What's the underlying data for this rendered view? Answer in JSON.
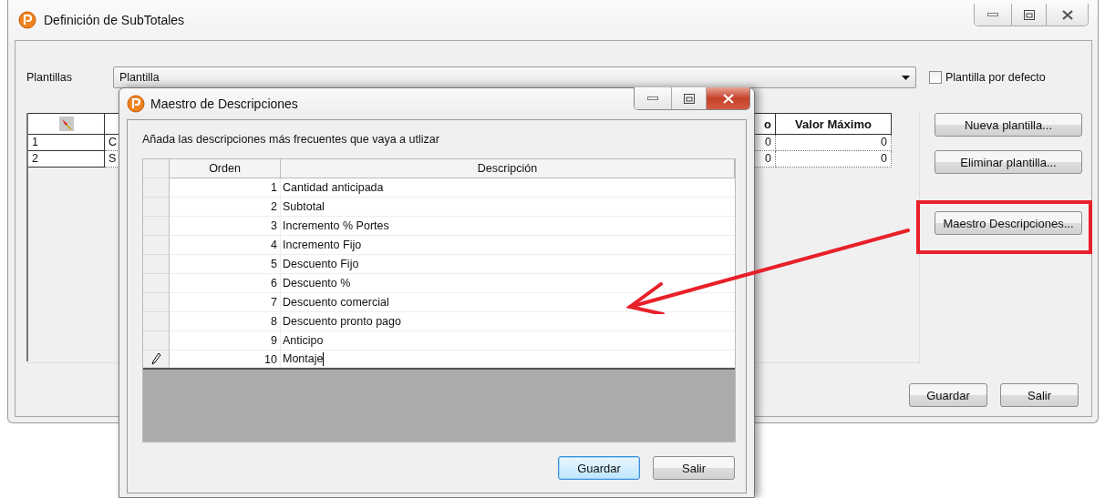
{
  "main_window": {
    "title": "Definición de SubTotales",
    "template_label": "Plantillas",
    "template_value": "Plantilla",
    "default_checkbox": {
      "label": "Plantilla por defecto",
      "checked": false
    },
    "table": {
      "columns": [
        {
          "kind": "pin"
        },
        {
          "kind": "blank"
        },
        {
          "kind": "text",
          "label": "o"
        },
        {
          "kind": "text",
          "label": "Valor Máximo"
        }
      ],
      "rows": [
        [
          "1",
          "C",
          "0",
          "0"
        ],
        [
          "2",
          "S",
          "0",
          "0"
        ]
      ]
    },
    "side_buttons": [
      "Nueva plantilla...",
      "Eliminar plantilla...",
      "Maestro Descripciones..."
    ],
    "footer_buttons": [
      "Guardar",
      "Salir"
    ]
  },
  "dialog": {
    "title": "Maestro de Descripciones",
    "instruction": "Añada las descripciones más frecuentes que vaya a utlizar",
    "columns": [
      "Orden",
      "Descripción"
    ],
    "rows": [
      {
        "order": "1",
        "description": "Cantidad anticipada",
        "editing": false
      },
      {
        "order": "2",
        "description": "Subtotal",
        "editing": false
      },
      {
        "order": "3",
        "description": "Incremento % Portes",
        "editing": false
      },
      {
        "order": "4",
        "description": "Incremento Fijo",
        "editing": false
      },
      {
        "order": "5",
        "description": "Descuento Fijo",
        "editing": false
      },
      {
        "order": "6",
        "description": "Descuento %",
        "editing": false
      },
      {
        "order": "7",
        "description": "Descuento comercial",
        "editing": false
      },
      {
        "order": "8",
        "description": "Descuento pronto pago",
        "editing": false
      },
      {
        "order": "9",
        "description": "Anticipo",
        "editing": false
      },
      {
        "order": "10",
        "description": "Montaje",
        "editing": true
      }
    ],
    "buttons": [
      {
        "label": "Guardar",
        "focused": true
      },
      {
        "label": "Salir",
        "focused": false
      }
    ]
  }
}
